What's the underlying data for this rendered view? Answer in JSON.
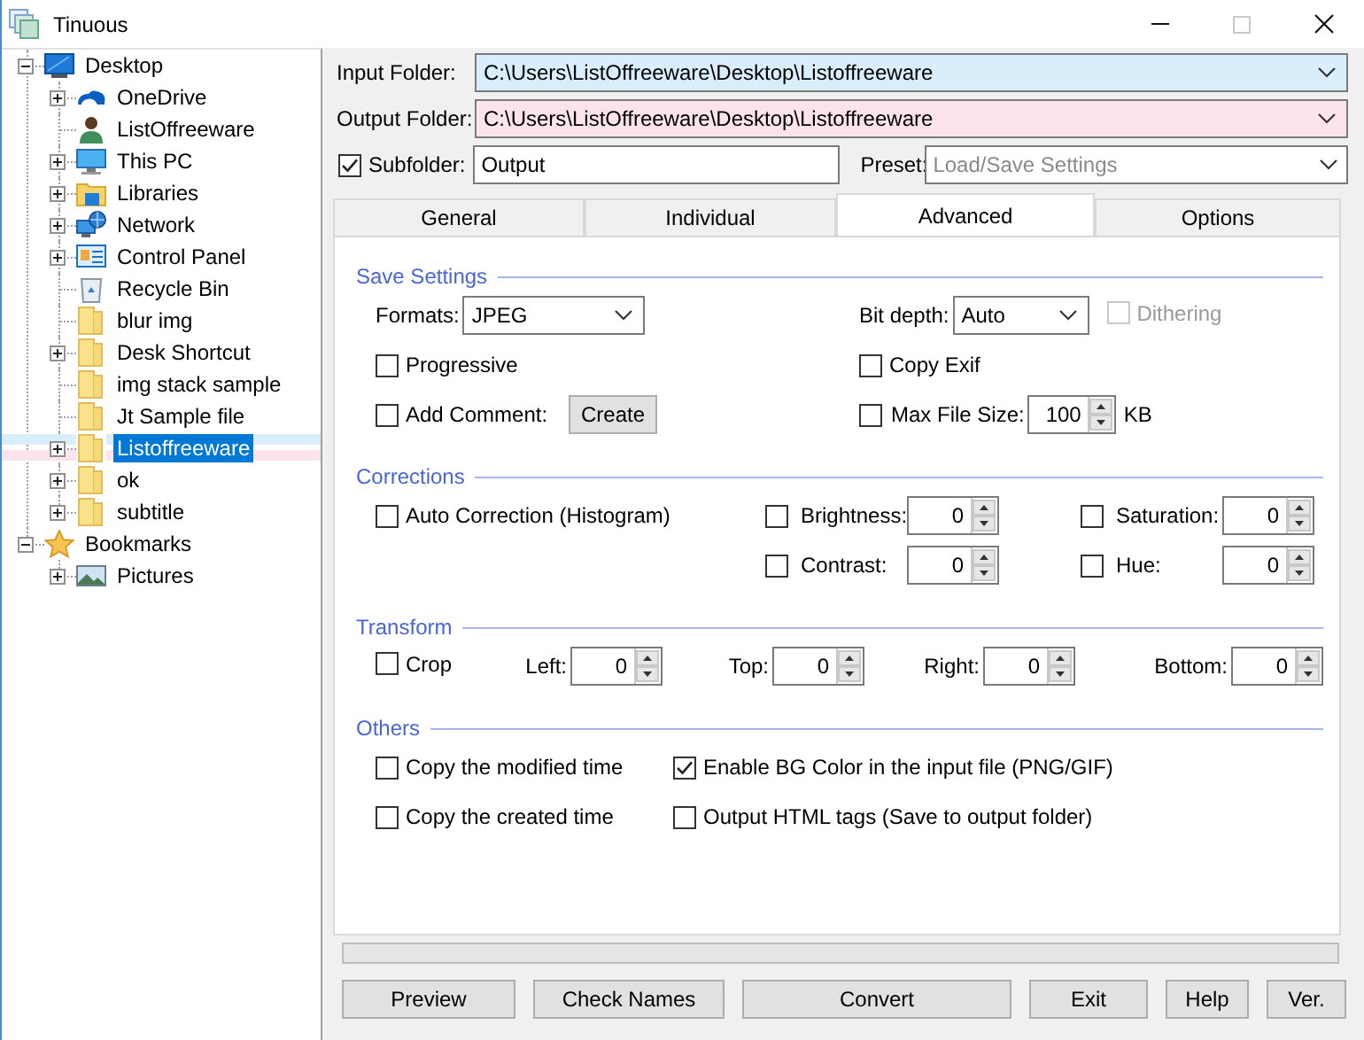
{
  "window": {
    "title": "Tinuous"
  },
  "tree": [
    {
      "label": "Desktop",
      "kind": "desktop",
      "expanded": true,
      "selected": false,
      "children": [
        {
          "label": "OneDrive",
          "kind": "cloud",
          "expanded": false,
          "selected": false
        },
        {
          "label": "ListOffreeware",
          "kind": "user",
          "selected": false
        },
        {
          "label": "This PC",
          "kind": "pc",
          "expanded": false,
          "selected": false
        },
        {
          "label": "Libraries",
          "kind": "library",
          "expanded": false,
          "selected": false
        },
        {
          "label": "Network",
          "kind": "network",
          "expanded": false,
          "selected": false
        },
        {
          "label": "Control Panel",
          "kind": "control",
          "expanded": false,
          "selected": false
        },
        {
          "label": "Recycle Bin",
          "kind": "bin",
          "selected": false
        },
        {
          "label": "blur img",
          "kind": "folder",
          "selected": false
        },
        {
          "label": "Desk Shortcut",
          "kind": "folder",
          "expanded": false,
          "selected": false
        },
        {
          "label": "img stack sample",
          "kind": "folder",
          "selected": false
        },
        {
          "label": "Jt Sample file",
          "kind": "folder",
          "selected": false
        },
        {
          "label": "Listoffreeware",
          "kind": "folder",
          "expanded": false,
          "selected": true
        },
        {
          "label": "ok",
          "kind": "folder",
          "expanded": false,
          "selected": false
        },
        {
          "label": "subtitle",
          "kind": "folder",
          "expanded": false,
          "selected": false
        }
      ]
    },
    {
      "label": "Bookmarks",
      "kind": "star",
      "expanded": true,
      "selected": false,
      "children": [
        {
          "label": "Pictures",
          "kind": "pictures",
          "expanded": false,
          "selected": false
        }
      ]
    }
  ],
  "folders": [
    {
      "label": "Input Folder:",
      "value": "C:\\Users\\ListOffreeware\\Desktop\\Listoffreeware",
      "color": "#d9edfb"
    },
    {
      "label": "Output Folder:",
      "value": "C:\\Users\\ListOffreeware\\Desktop\\Listoffreeware",
      "color": "#fde4ec"
    }
  ],
  "subfolder": {
    "label": "Subfolder:",
    "checked": true,
    "value": "Output"
  },
  "preset": {
    "label": "Preset:",
    "placeholder": "Load/Save Settings"
  },
  "tabs": [
    {
      "label": "General",
      "selected": false
    },
    {
      "label": "Individual",
      "selected": false
    },
    {
      "label": "Advanced",
      "selected": true
    },
    {
      "label": "Options",
      "selected": false
    }
  ],
  "save_settings": {
    "title": "Save Settings",
    "format": {
      "label": "Formats:",
      "value": "JPEG"
    },
    "bit_depth": {
      "label": "Bit depth:",
      "value": "Auto"
    },
    "dithering": {
      "label": "Dithering",
      "checked": false,
      "disabled": true
    },
    "progressive": {
      "label": "Progressive",
      "checked": false
    },
    "copy_exif": {
      "label": "Copy Exif",
      "checked": false
    },
    "add_comment": {
      "label": "Add Comment:",
      "checked": false
    },
    "create_button": "Create",
    "max_file_size": {
      "label": "Max File Size:",
      "checked": false,
      "value": "100",
      "unit": "KB"
    }
  },
  "corrections": {
    "title": "Corrections",
    "auto": {
      "label": "Auto Correction (Histogram)",
      "checked": false
    },
    "adjustments": [
      {
        "label": "Brightness:",
        "checked": false,
        "value": "0"
      },
      {
        "label": "Saturation:",
        "checked": false,
        "value": "0"
      },
      {
        "label": "Contrast:",
        "checked": false,
        "value": "0"
      },
      {
        "label": "Hue:",
        "checked": false,
        "value": "0"
      }
    ]
  },
  "transform": {
    "title": "Transform",
    "crop": {
      "label": "Crop",
      "checked": false
    },
    "margins": [
      {
        "label": "Left:",
        "value": "0"
      },
      {
        "label": "Top:",
        "value": "0"
      },
      {
        "label": "Right:",
        "value": "0"
      },
      {
        "label": "Bottom:",
        "value": "0"
      }
    ]
  },
  "others": {
    "title": "Others",
    "options": [
      {
        "label": "Copy the modified time",
        "checked": false
      },
      {
        "label": "Enable BG Color in the input file (PNG/GIF)",
        "checked": true
      },
      {
        "label": "Copy the created time",
        "checked": false
      },
      {
        "label": "Output HTML tags (Save to output folder)",
        "checked": false
      }
    ]
  },
  "progress": {
    "level": 0
  },
  "buttons": [
    "Preview",
    "Check Names",
    "Convert",
    "Exit",
    "Help",
    "Ver."
  ]
}
